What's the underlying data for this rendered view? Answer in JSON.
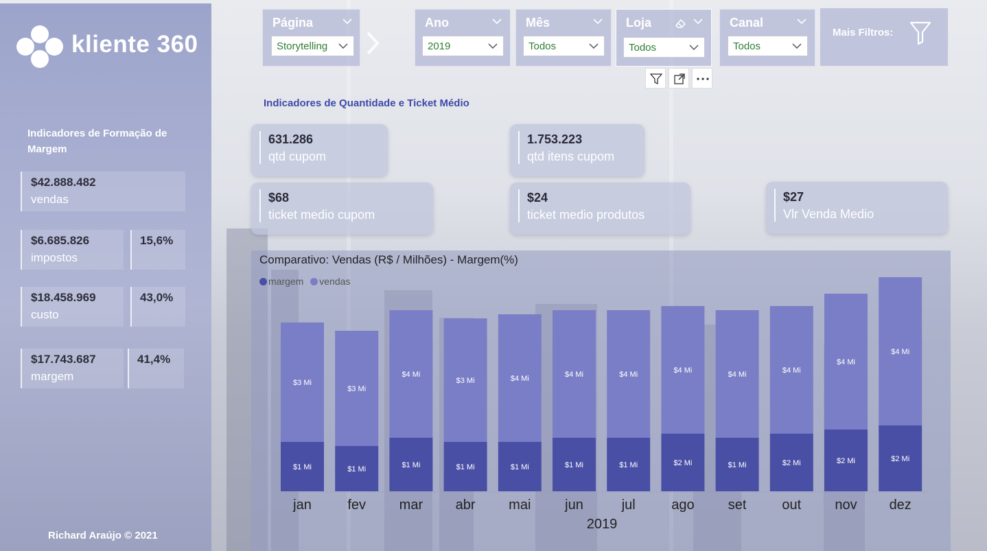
{
  "brand": {
    "name": "kliente 360",
    "credit": "Richard Araújo © 2021"
  },
  "sidebar": {
    "title": "Indicadores de Formação de Margem",
    "cards": [
      {
        "value": "$42.888.482",
        "label": "vendas",
        "pct": ""
      },
      {
        "value": "$6.685.826",
        "label": "impostos",
        "pct": "15,6%"
      },
      {
        "value": "$18.458.969",
        "label": "custo",
        "pct": "43,0%"
      },
      {
        "value": "$17.743.687",
        "label": "margem",
        "pct": "41,4%"
      }
    ]
  },
  "filters": {
    "pagina": {
      "title": "Página",
      "value": "Storytelling"
    },
    "ano": {
      "title": "Ano",
      "value": "2019"
    },
    "mes": {
      "title": "Mês",
      "value": "Todos"
    },
    "loja": {
      "title": "Loja",
      "value": "Todos"
    },
    "canal": {
      "title": "Canal",
      "value": "Todos"
    },
    "mais": {
      "label": "Mais Filtros:"
    }
  },
  "section_title": "Indicadores de Quantidade e Ticket Médio",
  "kpis": [
    {
      "value": "631.286",
      "label": "qtd cupom"
    },
    {
      "value": "1.753.223",
      "label": "qtd itens cupom"
    },
    {
      "value": "$68",
      "label": "ticket medio cupom"
    },
    {
      "value": "$24",
      "label": "ticket medio produtos"
    },
    {
      "value": "$27",
      "label": "Vlr Venda Medio"
    }
  ],
  "colors": {
    "vendas": "#7a7ec6",
    "margem": "#4a4fa6",
    "accent": "#3f4aa8"
  },
  "chart_data": {
    "type": "bar",
    "stacked": true,
    "title": "Comparativo: Vendas (R$ / Milhões) - Margem(%)",
    "xlabel": "2019",
    "categories": [
      "jan",
      "fev",
      "mar",
      "abr",
      "mai",
      "jun",
      "jul",
      "ago",
      "set",
      "out",
      "nov",
      "dez"
    ],
    "legend": [
      "margem",
      "vendas"
    ],
    "series": [
      {
        "name": "margem",
        "values": [
          1.2,
          1.1,
          1.3,
          1.2,
          1.2,
          1.3,
          1.3,
          1.4,
          1.3,
          1.4,
          1.5,
          1.6
        ],
        "labels": [
          "$1 Mi",
          "$1 Mi",
          "$1 Mi",
          "$1 Mi",
          "$1 Mi",
          "$1 Mi",
          "$1 Mi",
          "$2 Mi",
          "$1 Mi",
          "$2 Mi",
          "$2 Mi",
          "$2 Mi"
        ]
      },
      {
        "name": "vendas",
        "values": [
          2.9,
          2.8,
          3.1,
          3.0,
          3.1,
          3.1,
          3.1,
          3.1,
          3.1,
          3.1,
          3.3,
          3.6
        ],
        "labels": [
          "$3 Mi",
          "$3 Mi",
          "$4 Mi",
          "$3 Mi",
          "$4 Mi",
          "$4 Mi",
          "$4 Mi",
          "$4 Mi",
          "$4 Mi",
          "$4 Mi",
          "$4 Mi",
          "$4 Mi"
        ]
      }
    ]
  }
}
